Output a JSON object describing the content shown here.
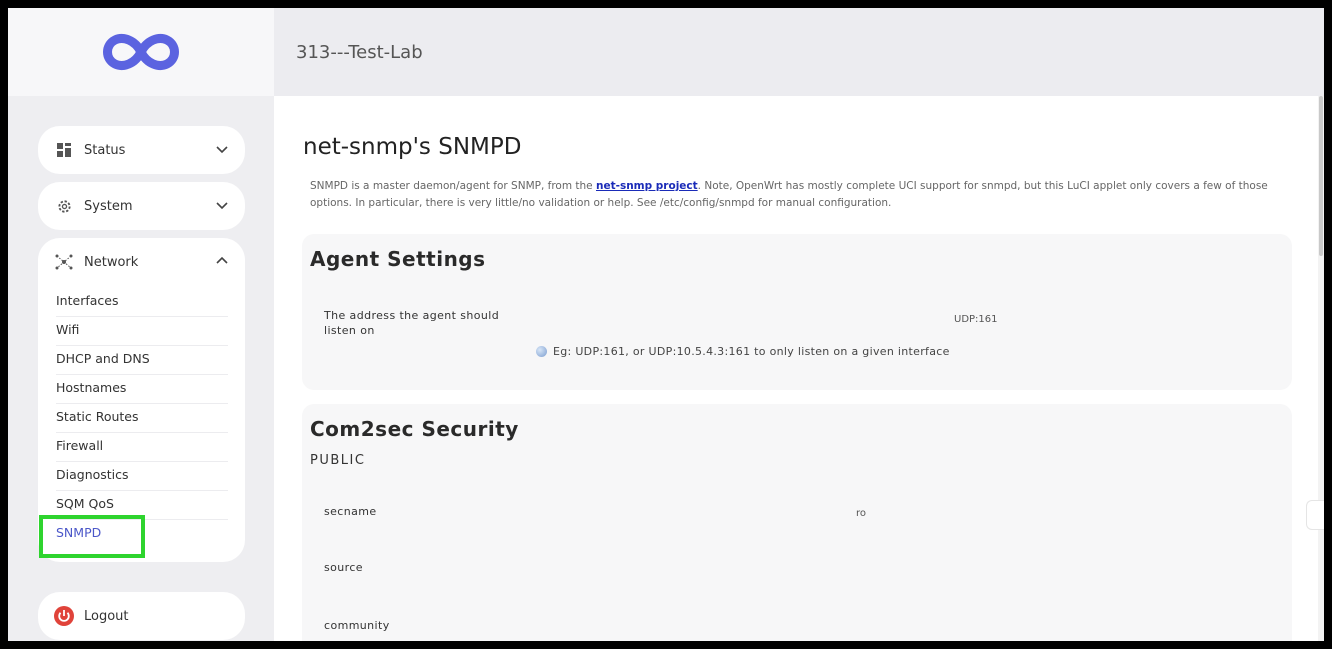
{
  "header": {
    "hostname": "313---Test-Lab"
  },
  "sidebar": {
    "status": {
      "label": "Status"
    },
    "system": {
      "label": "System"
    },
    "network": {
      "label": "Network",
      "items": [
        "Interfaces",
        "Wifi",
        "DHCP and DNS",
        "Hostnames",
        "Static Routes",
        "Firewall",
        "Diagnostics",
        "SQM QoS",
        "SNMPD"
      ],
      "active": "SNMPD"
    },
    "logout": {
      "label": "Logout"
    }
  },
  "main": {
    "title": "net-snmp's SNMPD",
    "description_before_link": "SNMPD is a master daemon/agent for SNMP, from the ",
    "description_link": "net-snmp project",
    "description_after_link": ". Note, OpenWrt has mostly complete UCI support for snmpd, but this LuCI applet only covers a few of those options. In particular, there is very little/no validation or help. See /etc/config/snmpd for manual configuration.",
    "agent_settings": {
      "heading": "Agent Settings",
      "address_label": "The address the agent should listen on",
      "address_value": "UDP:161",
      "address_hint": "Eg: UDP:161, or UDP:10.5.4.3:161 to only listen on a given interface"
    },
    "com2sec": {
      "heading": "Com2sec Security",
      "subheading": "PUBLIC",
      "secname_label": "secname",
      "secname_value": "ro",
      "source_label": "source",
      "community_label": "community"
    }
  },
  "colors": {
    "accent": "#4b57c9",
    "logo": "#5b63e0",
    "highlight": "#2ed42e",
    "logout": "#e0433a"
  }
}
